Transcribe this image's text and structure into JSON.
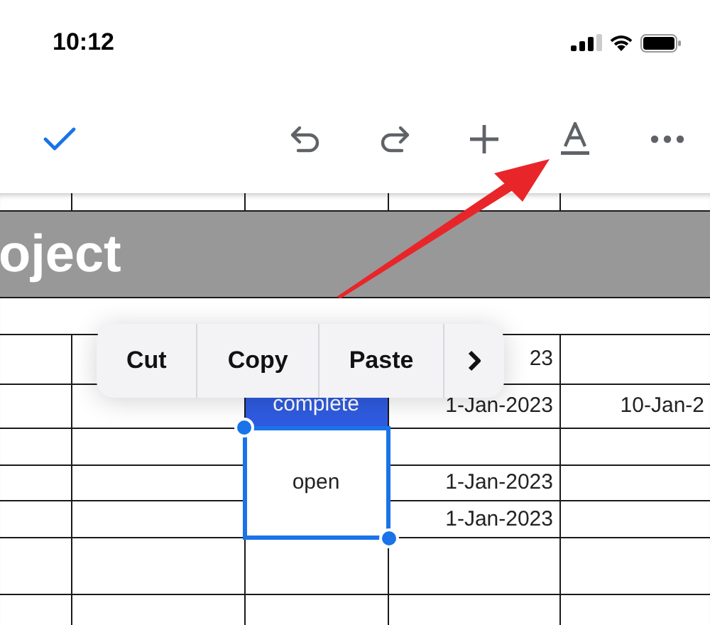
{
  "status_bar": {
    "time": "10:12"
  },
  "sheet": {
    "title": "oject",
    "cells": [
      {
        "text": "23"
      },
      {
        "text": "complete",
        "color": "#2f5be0"
      },
      {
        "text": "1-Jan-2023"
      },
      {
        "text": "10-Jan-2"
      },
      {
        "text": "open",
        "selected": true
      },
      {
        "text": "1-Jan-2023"
      },
      {
        "text": "1-Jan-2023"
      }
    ]
  },
  "context_menu": {
    "items": [
      "Cut",
      "Copy",
      "Paste"
    ]
  }
}
